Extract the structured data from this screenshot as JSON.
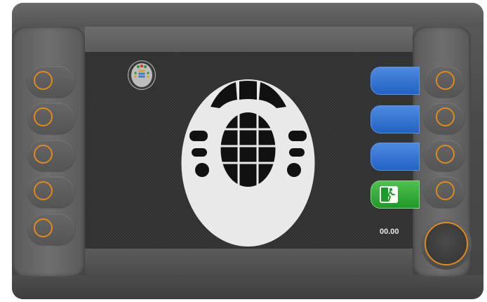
{
  "screen": {
    "time_display": "00.00"
  },
  "left_buttons": [
    {
      "id": "left-1"
    },
    {
      "id": "left-2"
    },
    {
      "id": "left-3"
    },
    {
      "id": "left-4"
    },
    {
      "id": "left-5"
    }
  ],
  "right_buttons": [
    {
      "id": "right-1"
    },
    {
      "id": "right-2"
    },
    {
      "id": "right-3"
    },
    {
      "id": "right-4"
    }
  ],
  "softkeys": [
    {
      "name": "softkey-1",
      "color": "#2f6fd0"
    },
    {
      "name": "softkey-2",
      "color": "#2f6fd0"
    },
    {
      "name": "softkey-3",
      "color": "#2f6fd0"
    },
    {
      "name": "exit-softkey",
      "color": "#2aa832",
      "icon": "exit-door-icon"
    }
  ],
  "colors": {
    "accent_ring": "#e08a1e",
    "softkey_blue": "#2f6fd0",
    "exit_green": "#2aa832"
  }
}
